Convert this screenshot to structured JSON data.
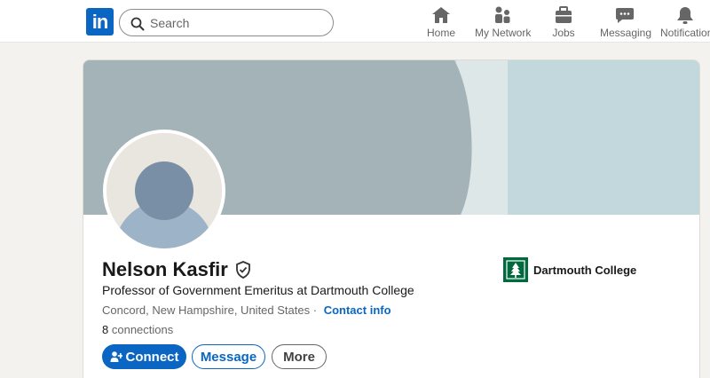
{
  "nav": {
    "logo_text": "in",
    "search_placeholder": "Search",
    "items": [
      {
        "label": "Home",
        "icon": "home-icon"
      },
      {
        "label": "My Network",
        "icon": "my-network-icon"
      },
      {
        "label": "Jobs",
        "icon": "jobs-icon"
      },
      {
        "label": "Messaging",
        "icon": "messaging-icon"
      },
      {
        "label": "Notifications",
        "icon": "bell-icon"
      }
    ]
  },
  "profile": {
    "name": "Nelson Kasfir",
    "headline": "Professor of Government Emeritus at Dartmouth College",
    "location": "Concord, New Hampshire, United States",
    "separator": "·",
    "contact_info_label": "Contact info",
    "connections_count": "8",
    "connections_label": "connections",
    "buttons": {
      "connect": "Connect",
      "message": "Message",
      "more": "More"
    },
    "organization": "Dartmouth College"
  },
  "colors": {
    "brand": "#0a66c2",
    "org_logo": "#00693e",
    "banner_dark": "#a3b3b8",
    "banner_light": "#c3d8dd"
  }
}
